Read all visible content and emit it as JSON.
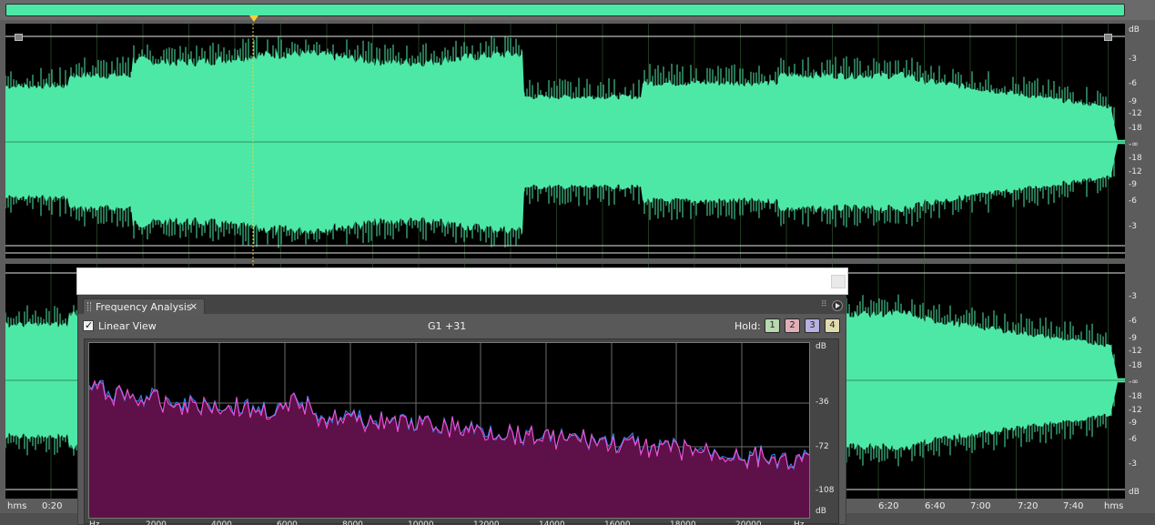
{
  "overview": {
    "color": "#4ee8a6"
  },
  "waveform": {
    "color": "#4ee8a6",
    "background": "#000000",
    "db_labels": [
      "dB",
      "-3",
      "-6",
      "-9",
      "-12",
      "-18",
      "-∞",
      "-18",
      "-12",
      "-9",
      "-6",
      "-3",
      "-3",
      "-6",
      "-9",
      "-12",
      "-18",
      "-∞",
      "-18",
      "-12",
      "-9",
      "-6",
      "-3",
      "dB"
    ],
    "timeline": {
      "unit_left": "hms",
      "unit_right": "hms",
      "labels": [
        "0:20",
        "6:20",
        "6:40",
        "7:00",
        "7:20",
        "7:40"
      ]
    }
  },
  "frequency_analysis": {
    "tab_title": "Frequency Analysis",
    "close_glyph": "×",
    "linear_view_label": "Linear View",
    "linear_view_checked": true,
    "position_readout": "G1 +31",
    "hold_label": "Hold:",
    "hold_buttons": [
      {
        "label": "1",
        "color": "#b8d8b0"
      },
      {
        "label": "2",
        "color": "#e0b0b8"
      },
      {
        "label": "3",
        "color": "#b8b0e0"
      },
      {
        "label": "4",
        "color": "#e0dcb0"
      }
    ],
    "db_labels": [
      "dB",
      "-36",
      "-72",
      "-108",
      "dB"
    ],
    "freq_labels": [
      "Hz",
      "2000",
      "4000",
      "6000",
      "8000",
      "10000",
      "12000",
      "14000",
      "16000",
      "18000",
      "20000",
      "Hz"
    ],
    "colors": {
      "fill": "#5e1049",
      "trace_left": "#2a8cff",
      "trace_right": "#ff4fd0"
    }
  }
}
